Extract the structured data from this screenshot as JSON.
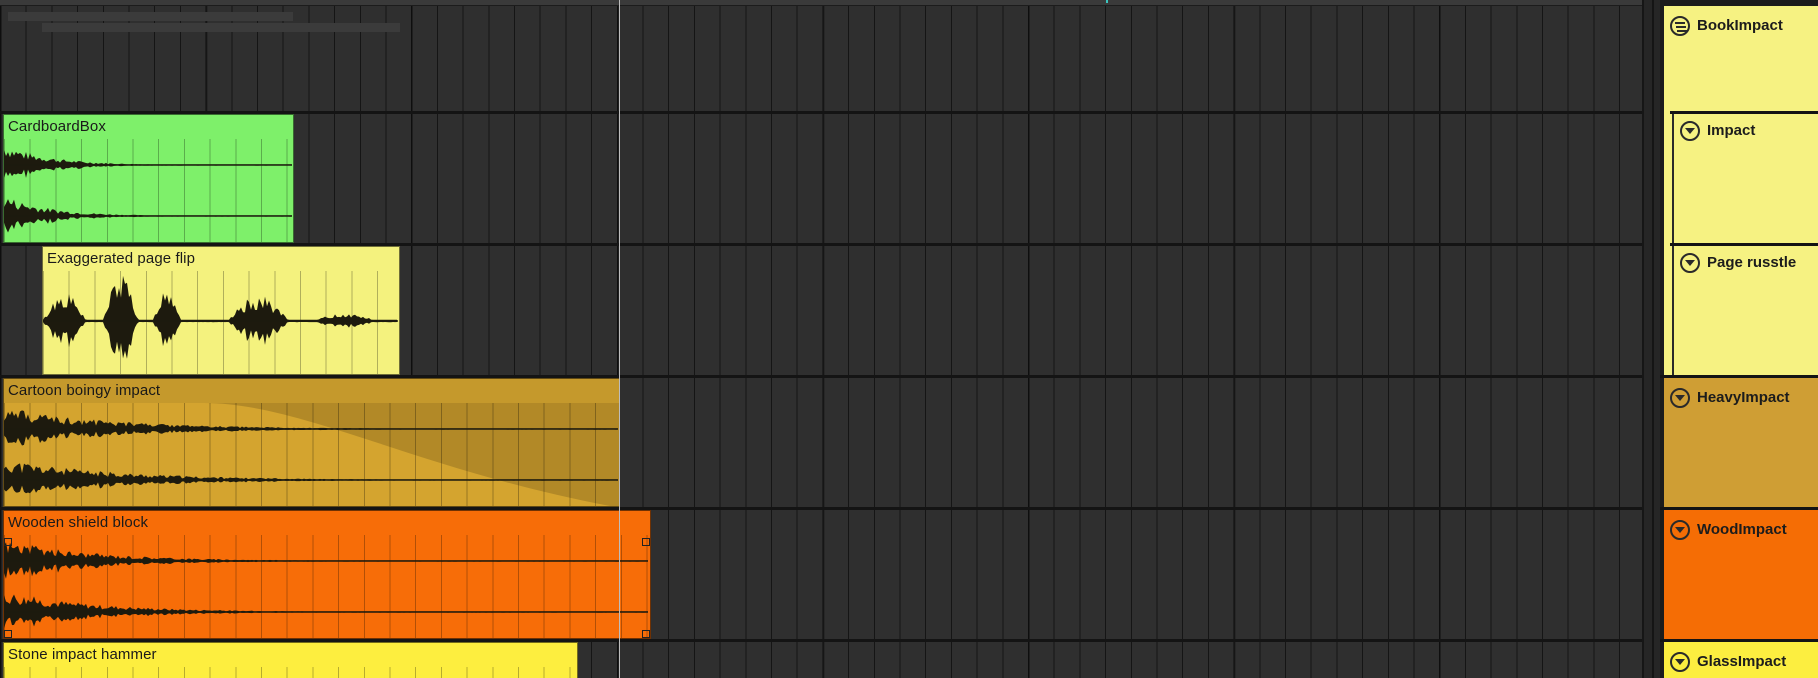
{
  "clips": [
    {
      "name": "CardboardBox",
      "color": "#7ef06a"
    },
    {
      "name": "Exaggerated page flip",
      "color": "#f4f27e"
    },
    {
      "name": "Cartoon boingy impact",
      "color": "#d4a42f"
    },
    {
      "name": "Wooden shield block",
      "color": "#f76d08"
    },
    {
      "name": "Stone impact hammer",
      "color": "#fdee3f"
    }
  ],
  "tracks": [
    {
      "name": "BookImpact",
      "color": "#f6f282",
      "icon": "group-fold-icon"
    },
    {
      "name": "Impact",
      "color": "#f6f282",
      "icon": "fold-arrow-icon"
    },
    {
      "name": "Page russtle",
      "color": "#f6f282",
      "icon": "fold-arrow-icon"
    },
    {
      "name": "HeavyImpact",
      "color": "#cf9e34",
      "icon": "fold-arrow-icon"
    },
    {
      "name": "WoodImpact",
      "color": "#f56d05",
      "icon": "fold-arrow-icon"
    },
    {
      "name": "GlassImpact",
      "color": "#fcee40",
      "icon": "fold-arrow-icon"
    }
  ],
  "colors": {
    "arrangement_bg": "#2f2f2f",
    "playhead": "#bdbdbd",
    "waveform": "#1d1a0e"
  }
}
